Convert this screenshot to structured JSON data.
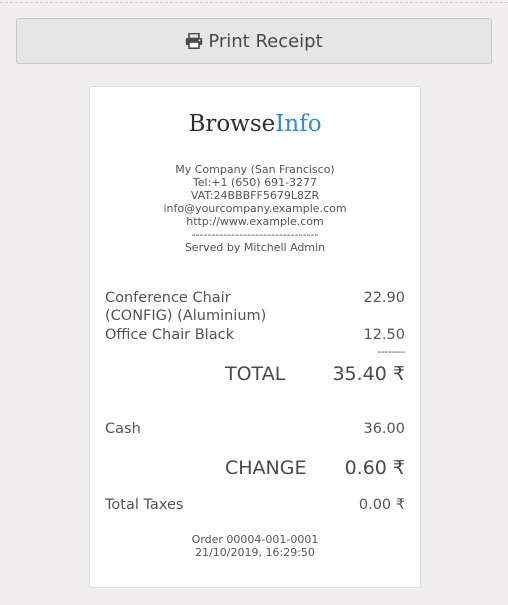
{
  "toolbar": {
    "print_label": "Print Receipt"
  },
  "receipt": {
    "logo": {
      "part1": "Browse",
      "part2": "Info",
      "accent_color": "#2f8fcc"
    },
    "header_lines": [
      "My Company (San Francisco)",
      "Tel:+1 (650) 691-3277",
      "VAT:24BBBFF5679L8ZR",
      "info@yourcompany.example.com",
      "http://www.example.com",
      "--------------------------------",
      "Served by Mitchell Admin"
    ],
    "lines": [
      {
        "name_line1": "Conference Chair",
        "name_line2": "(CONFIG) (Aluminium)",
        "price": "22.90"
      },
      {
        "name_line1": "Office Chair Black",
        "price": "12.50"
      }
    ],
    "subtotal_dashes": "--------",
    "total": {
      "label": "TOTAL",
      "amount": "35.40 ₹"
    },
    "payment": {
      "label": "Cash",
      "amount": "36.00"
    },
    "change": {
      "label": "CHANGE",
      "amount": "0.60 ₹"
    },
    "taxes": {
      "label": "Total Taxes",
      "amount": "0.00 ₹"
    },
    "order": {
      "ref": "Order 00004-001-0001",
      "datetime": "21/10/2019, 16:29:50"
    }
  }
}
